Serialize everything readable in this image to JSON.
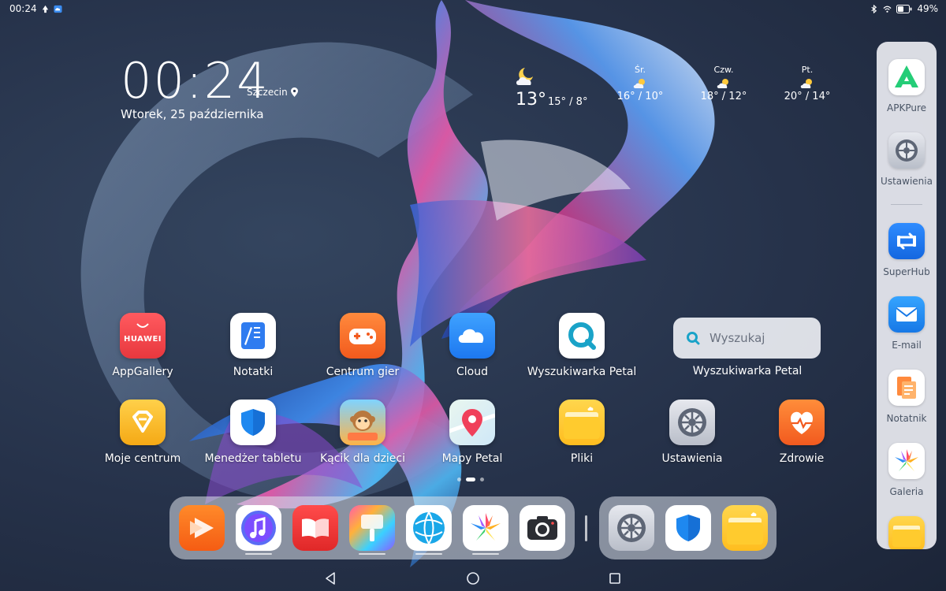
{
  "status_bar": {
    "time": "00:24",
    "battery_percent": "49%",
    "icons": [
      "upload-icon",
      "cloud-icon",
      "bluetooth-icon",
      "wifi-icon",
      "battery-icon"
    ]
  },
  "clock_widget": {
    "time": "00:24",
    "city": "Szczecin",
    "date": "Wtorek, 25 października"
  },
  "weather_widget": {
    "today": {
      "temp": "13°",
      "range": "15° / 8°",
      "icon": "moon-cloud-icon"
    },
    "days": [
      {
        "name": "Śr.",
        "range": "16° / 10°",
        "icon": "partly-cloudy-icon"
      },
      {
        "name": "Czw.",
        "range": "18° / 12°",
        "icon": "partly-cloudy-icon"
      },
      {
        "name": "Pt.",
        "range": "20° / 14°",
        "icon": "partly-cloudy-icon"
      }
    ]
  },
  "apps": {
    "row1": [
      {
        "label": "AppGallery",
        "icon": "appgallery-icon",
        "badge_text": "HUAWEI"
      },
      {
        "label": "Notatki",
        "icon": "notes-icon"
      },
      {
        "label": "Centrum gier",
        "icon": "gamepad-icon"
      },
      {
        "label": "Cloud",
        "icon": "cloud-app-icon"
      },
      {
        "label": "Wyszukiwarka Petal",
        "icon": "petal-search-icon"
      }
    ],
    "row2": [
      {
        "label": "Moje centrum",
        "icon": "diamond-icon"
      },
      {
        "label": "Menedżer tabletu",
        "icon": "shield-icon"
      },
      {
        "label": "Kącik dla dzieci",
        "icon": "kids-corner-icon"
      },
      {
        "label": "Mapy Petal",
        "icon": "map-pin-icon"
      },
      {
        "label": "Pliki",
        "icon": "folder-icon"
      },
      {
        "label": "Ustawienia",
        "icon": "settings-gear-icon"
      },
      {
        "label": "Zdrowie",
        "icon": "heart-icon"
      }
    ]
  },
  "search_widget": {
    "placeholder": "Wyszukaj",
    "label": "Wyszukiwarka Petal"
  },
  "page_indicator": {
    "pages": 3,
    "current": 2
  },
  "dock": {
    "apps": [
      "video-icon",
      "music-icon",
      "books-icon",
      "themes-icon",
      "browser-icon",
      "gallery-icon",
      "camera-icon"
    ],
    "recent": [
      "settings-gear-icon",
      "shield-icon",
      "folder-icon"
    ]
  },
  "side_panel": {
    "apps": [
      {
        "label": "APKPure",
        "icon": "apkpure-icon"
      },
      {
        "label": "Ustawienia",
        "icon": "settings-gear-icon"
      },
      {
        "label": "SuperHub",
        "icon": "superhub-icon"
      },
      {
        "label": "E-mail",
        "icon": "email-icon"
      },
      {
        "label": "Notatnik",
        "icon": "notepad-icon"
      },
      {
        "label": "Galeria",
        "icon": "gallery-icon"
      },
      {
        "label": "",
        "icon": "folder-icon"
      }
    ]
  },
  "nav_bar": {
    "buttons": [
      "back-icon",
      "home-icon",
      "recents-icon"
    ]
  }
}
